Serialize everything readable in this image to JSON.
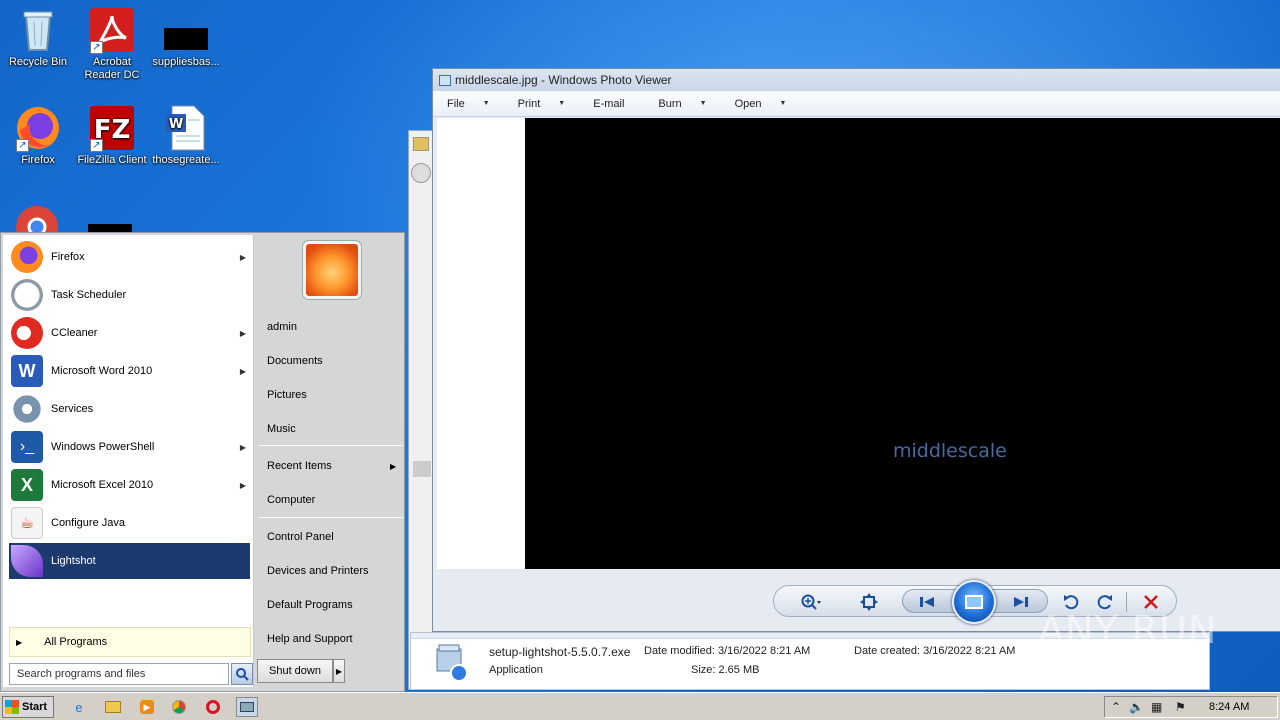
{
  "desktop": {
    "icons": [
      {
        "label": "Recycle Bin"
      },
      {
        "label": "Acrobat Reader DC"
      },
      {
        "label": "suppliesbas..."
      },
      {
        "label": "Firefox"
      },
      {
        "label": "FileZilla Client"
      },
      {
        "label": "thosegreate..."
      }
    ]
  },
  "photo_viewer": {
    "title": "middlescale.jpg - Windows Photo Viewer",
    "menu": [
      "File",
      "Print",
      "E-mail",
      "Burn",
      "Open"
    ],
    "image_text": "middlescale"
  },
  "details": {
    "filename": "setup-lightshot-5.5.0.7.exe",
    "type": "Application",
    "date_modified": "Date modified: 3/16/2022 8:21 AM",
    "size": "Size: 2.65 MB",
    "date_created": "Date created: 3/16/2022 8:21 AM"
  },
  "start_menu": {
    "programs": [
      {
        "label": "Firefox",
        "has_submenu": true
      },
      {
        "label": "Task Scheduler",
        "has_submenu": false
      },
      {
        "label": "CCleaner",
        "has_submenu": true
      },
      {
        "label": "Microsoft Word 2010",
        "has_submenu": true
      },
      {
        "label": "Services",
        "has_submenu": false
      },
      {
        "label": "Windows PowerShell",
        "has_submenu": true
      },
      {
        "label": "Microsoft Excel 2010",
        "has_submenu": true
      },
      {
        "label": "Configure Java",
        "has_submenu": false
      },
      {
        "label": "Lightshot",
        "has_submenu": false,
        "selected": true
      }
    ],
    "all_programs": "All Programs",
    "search_placeholder": "Search programs and files",
    "right_links": [
      "admin",
      "Documents",
      "Pictures",
      "Music",
      "Recent Items",
      "Computer",
      "Control Panel",
      "Devices and Printers",
      "Default Programs",
      "Help and Support"
    ],
    "shutdown": "Shut down"
  },
  "taskbar": {
    "start": "Start",
    "clock": "8:24 AM"
  },
  "watermark": "ANY RUN"
}
